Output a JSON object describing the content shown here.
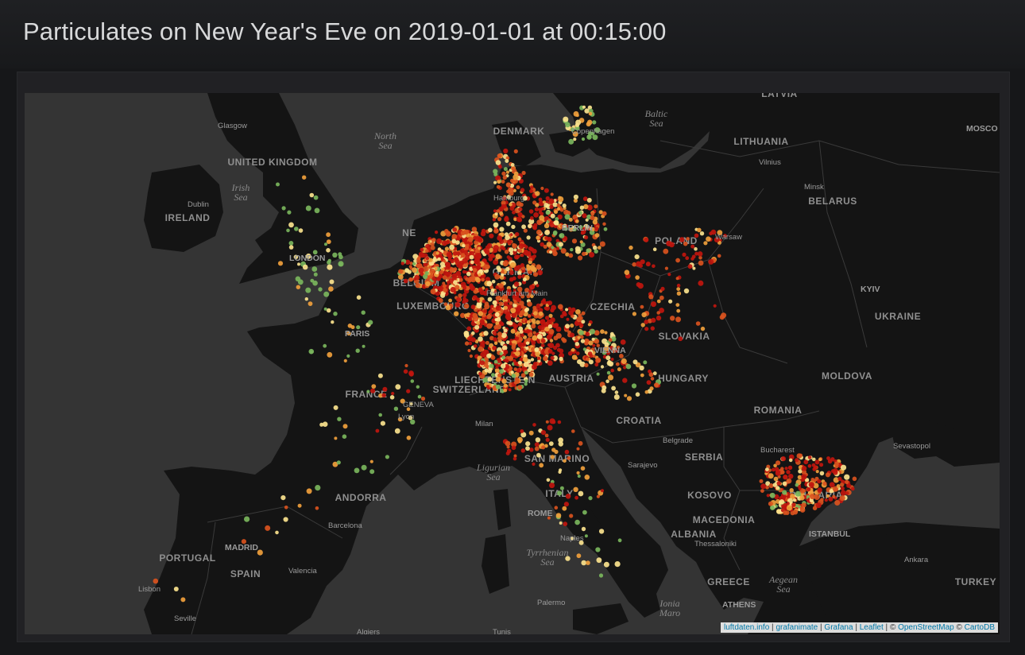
{
  "page": {
    "title": "Particulates on New Year's Eve on 2019-01-01 at 00:15:00"
  },
  "map": {
    "land_color": "#141414",
    "sea_color": "#343434",
    "border_color": "#3a3a3a",
    "marker_colors": {
      "high": "#c0160e",
      "elevated": "#d9531e",
      "moderate": "#f0a03c",
      "light": "#fbe38e",
      "low": "#7ab55c"
    },
    "country_labels": [
      {
        "id": "uk",
        "text": "UNITED KINGDOM"
      },
      {
        "id": "ireland",
        "text": "IRELAND"
      },
      {
        "id": "denmark",
        "text": "DENMARK"
      },
      {
        "id": "lithuania",
        "text": "LITHUANIA"
      },
      {
        "id": "belarus",
        "text": "BELARUS"
      },
      {
        "id": "latvia",
        "text": "LATVIA"
      },
      {
        "id": "poland",
        "text": "POLAND"
      },
      {
        "id": "germany",
        "text": "GERMANY"
      },
      {
        "id": "belgium",
        "text": "BELGIUM"
      },
      {
        "id": "netherlands",
        "text": "NE"
      },
      {
        "id": "luxembourg",
        "text": "LUXEMBOURG"
      },
      {
        "id": "czechia",
        "text": "CZECHIA"
      },
      {
        "id": "slovakia",
        "text": "SLOVAKIA"
      },
      {
        "id": "ukraine",
        "text": "UKRAINE"
      },
      {
        "id": "france",
        "text": "FRANCE"
      },
      {
        "id": "switzerland",
        "text": "SWITZERLAND"
      },
      {
        "id": "liechtenstein",
        "text": "LIECHTENSTEIN"
      },
      {
        "id": "austria",
        "text": "AUSTRIA"
      },
      {
        "id": "hungary",
        "text": "HUNGARY"
      },
      {
        "id": "moldova",
        "text": "MOLDOVA"
      },
      {
        "id": "romania",
        "text": "ROMANIA"
      },
      {
        "id": "croatia",
        "text": "CROATIA"
      },
      {
        "id": "serbia",
        "text": "SERBIA"
      },
      {
        "id": "san_marino",
        "text": "SAN MARINO"
      },
      {
        "id": "italy",
        "text": "ITALY"
      },
      {
        "id": "andorra",
        "text": "ANDORRA"
      },
      {
        "id": "bulgaria",
        "text": "BULGARIA"
      },
      {
        "id": "kosovo",
        "text": "KOSOVO"
      },
      {
        "id": "macedonia",
        "text": "MACEDONIA"
      },
      {
        "id": "albania",
        "text": "ALBANIA"
      },
      {
        "id": "portugal",
        "text": "PORTUGAL"
      },
      {
        "id": "spain",
        "text": "SPAIN"
      },
      {
        "id": "greece",
        "text": "GREECE"
      },
      {
        "id": "turkey",
        "text": "TURKEY"
      }
    ],
    "sea_labels": [
      {
        "id": "north_sea",
        "line1": "North",
        "line2": "Sea"
      },
      {
        "id": "baltic_sea",
        "line1": "Baltic",
        "line2": "Sea"
      },
      {
        "id": "irish_sea",
        "line1": "Irish",
        "line2": "Sea"
      },
      {
        "id": "ligurian_sea",
        "line1": "Ligurian",
        "line2": "Sea"
      },
      {
        "id": "tyrrhenian_sea",
        "line1": "Tyrrhenian",
        "line2": "Sea"
      },
      {
        "id": "aegean_sea",
        "line1": "Aegean",
        "line2": "Sea"
      },
      {
        "id": "ionian_sea",
        "line1": "Ionia",
        "line2": "Maro"
      }
    ],
    "city_labels": [
      {
        "id": "glasgow",
        "text": "Glasgow"
      },
      {
        "id": "dublin",
        "text": "Dublin"
      },
      {
        "id": "london",
        "text": "LONDON"
      },
      {
        "id": "copenhagen",
        "text": "Copenhagen"
      },
      {
        "id": "hamburg",
        "text": "Hamburg"
      },
      {
        "id": "berlin",
        "text": "BERLIN"
      },
      {
        "id": "vilnius",
        "text": "Vilnius"
      },
      {
        "id": "minsk",
        "text": "Minsk"
      },
      {
        "id": "warsaw",
        "text": "Warsaw"
      },
      {
        "id": "moscow",
        "text": "MOSCO"
      },
      {
        "id": "kyiv",
        "text": "KYIV"
      },
      {
        "id": "frankfurt",
        "text": "Frankfurt am Main"
      },
      {
        "id": "paris",
        "text": "PARIS"
      },
      {
        "id": "vienna",
        "text": "VIENNA"
      },
      {
        "id": "geneva",
        "text": "GENEVA"
      },
      {
        "id": "lyon",
        "text": "Lyon"
      },
      {
        "id": "milan",
        "text": "Milan"
      },
      {
        "id": "belgrade",
        "text": "Belgrade"
      },
      {
        "id": "sarajevo",
        "text": "Sarajevo"
      },
      {
        "id": "bucharest",
        "text": "Bucharest"
      },
      {
        "id": "sevastopol",
        "text": "Sevastopol"
      },
      {
        "id": "rome",
        "text": "ROME"
      },
      {
        "id": "naples",
        "text": "Naples"
      },
      {
        "id": "barcelona",
        "text": "Barcelona"
      },
      {
        "id": "madrid",
        "text": "MADRID"
      },
      {
        "id": "valencia",
        "text": "Valencia"
      },
      {
        "id": "lisbon",
        "text": "Lisbon"
      },
      {
        "id": "seville",
        "text": "Seville"
      },
      {
        "id": "thessaloniki",
        "text": "Thessaloniki"
      },
      {
        "id": "istanbul",
        "text": "ISTANBUL"
      },
      {
        "id": "ankara",
        "text": "Ankara"
      },
      {
        "id": "athens",
        "text": "ATHENS"
      },
      {
        "id": "palermo",
        "text": "Palermo"
      },
      {
        "id": "algiers",
        "text": "Algiers"
      },
      {
        "id": "tunis",
        "text": "Tunis"
      }
    ]
  },
  "attribution": {
    "luftdaten": "luftdaten.info",
    "grafanimate": "grafanimate",
    "grafana": "Grafana",
    "leaflet": "Leaflet",
    "copyright_symbol": "©",
    "osm": "OpenStreetMap",
    "carto": "CartoDB",
    "separator": "|"
  }
}
